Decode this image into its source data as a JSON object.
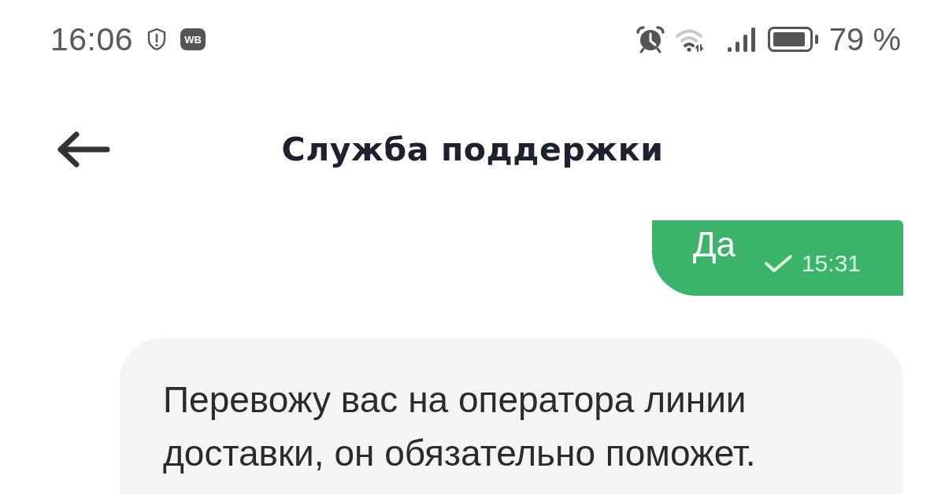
{
  "status_bar": {
    "time": "16:06",
    "app_badge": "WB",
    "battery_percent": "79 %"
  },
  "header": {
    "title": "Служба поддержки"
  },
  "messages": [
    {
      "kind": "outgoing",
      "text": "Да",
      "time": "15:31",
      "delivered": true
    },
    {
      "kind": "incoming",
      "text": "Перевожу вас на оператора линии доставки, он обязательно поможет."
    }
  ]
}
